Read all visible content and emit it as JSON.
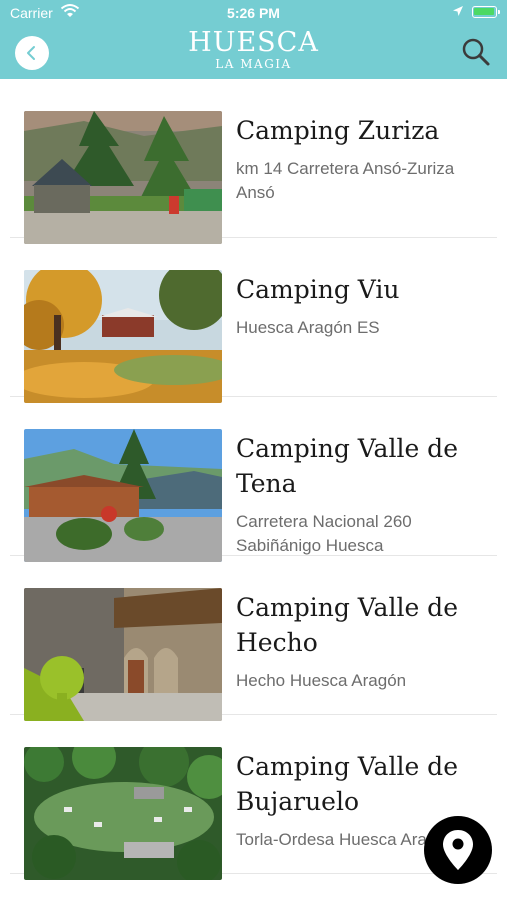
{
  "status_bar": {
    "carrier": "Carrier",
    "time": "5:26 PM"
  },
  "header": {
    "logo_main": "HUESCA",
    "logo_sub": "LA MAGIA",
    "back_icon": "chevron-left-icon",
    "search_icon": "search-icon",
    "background_color": "#75cdd2"
  },
  "campings": [
    {
      "title": "Camping Zuriza",
      "address": "km 14 Carretera Ansó-Zuriza Ansó"
    },
    {
      "title": "Camping Viu",
      "address": "Huesca Aragón ES"
    },
    {
      "title": "Camping Valle de Tena",
      "address": "Carretera Nacional 260 Sabiñánigo Huesca"
    },
    {
      "title": "Camping Valle de Hecho",
      "address": "Hecho Huesca Aragón"
    },
    {
      "title": "Camping Valle de Bujaruelo",
      "address": "Torla-Ordesa Huesca Aragón"
    }
  ],
  "map_button": {
    "icon": "map-pin-icon"
  }
}
